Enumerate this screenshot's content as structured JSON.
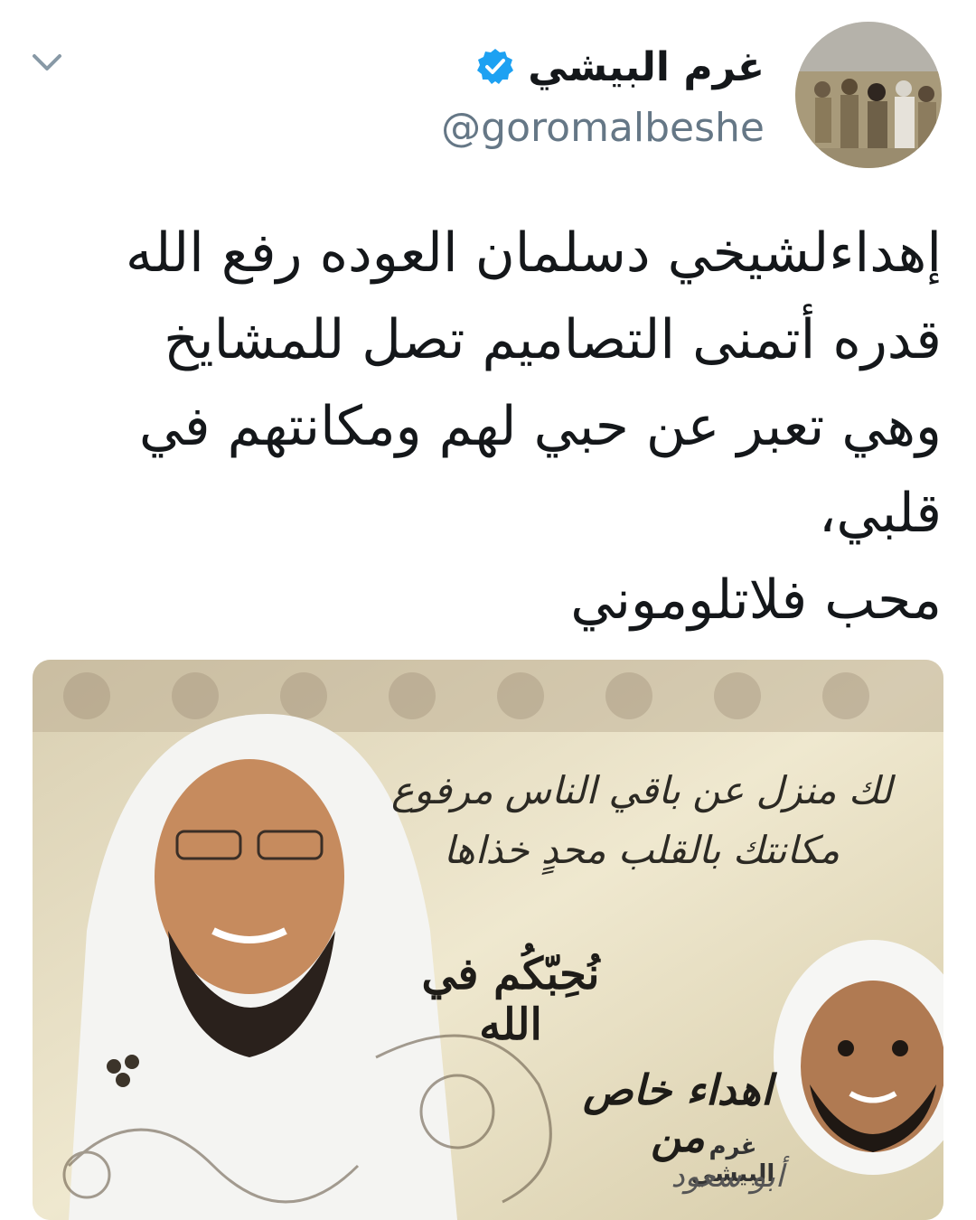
{
  "tweet": {
    "author": {
      "display_name": "غرم البيشي",
      "handle": "@goromalbeshe",
      "verified": true
    },
    "text": "إهداءلشيخي دسلمان العوده رفع الله\nقدره أتمنى التصاميم تصل للمشايخ\nوهي تعبر عن حبي لهم ومكانتهم في\nقلبي،\nمحب فلاتلوموني",
    "icons": {
      "menu": "chevron-down-icon",
      "verified": "verified-badge-icon"
    },
    "colors": {
      "accent": "#1da1f2",
      "name": "#14171a",
      "handle": "#657786"
    }
  },
  "media": {
    "poem_lines": [
      "لك منزل عن باقي الناس مرفوع",
      "مكانتك بالقلب محدٍ خذاها"
    ],
    "blessing": "نُحِبّكُم في الله",
    "gift_line1": "اهداء خاص",
    "gift_line2": "من",
    "signature_name": "غرم البيشي",
    "signature_nickname": "أبو سعود"
  }
}
